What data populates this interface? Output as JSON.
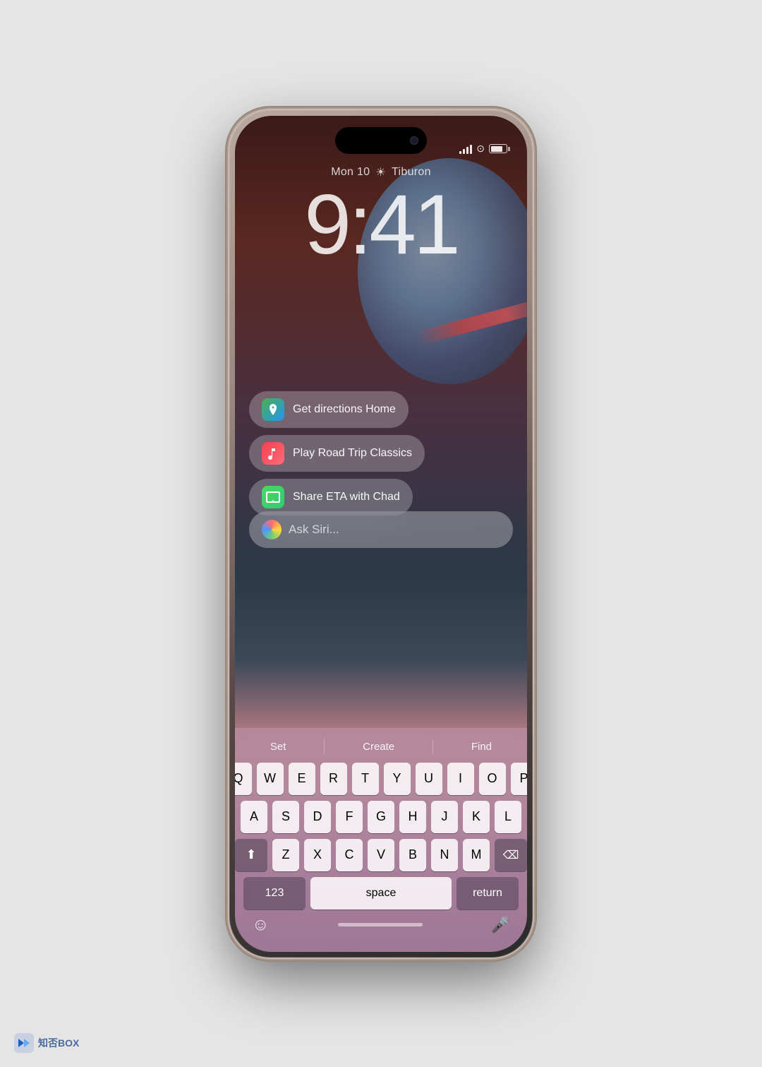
{
  "phone": {
    "status": {
      "time": "9:41",
      "date": "Mon 10",
      "weather_icon": "☀",
      "location": "Tiburon"
    },
    "suggestions": [
      {
        "id": "directions",
        "icon_type": "maps",
        "icon_emoji": "🗺",
        "text": "Get directions Home"
      },
      {
        "id": "music",
        "icon_type": "music",
        "icon_emoji": "♪",
        "text": "Play Road Trip Classics"
      },
      {
        "id": "messages",
        "icon_type": "messages",
        "icon_emoji": "💬",
        "text": "Share ETA with Chad"
      }
    ],
    "siri_placeholder": "Ask Siri...",
    "keyboard": {
      "quick_actions": [
        "Set",
        "Create",
        "Find"
      ],
      "row1": [
        "Q",
        "W",
        "E",
        "R",
        "T",
        "Y",
        "U",
        "I",
        "O",
        "P"
      ],
      "row2": [
        "A",
        "S",
        "D",
        "F",
        "G",
        "H",
        "J",
        "K",
        "L"
      ],
      "row3": [
        "Z",
        "X",
        "C",
        "V",
        "B",
        "N",
        "M"
      ],
      "bottom": [
        "123",
        "space",
        "return"
      ]
    }
  },
  "watermark": {
    "text": "知否BOX"
  }
}
